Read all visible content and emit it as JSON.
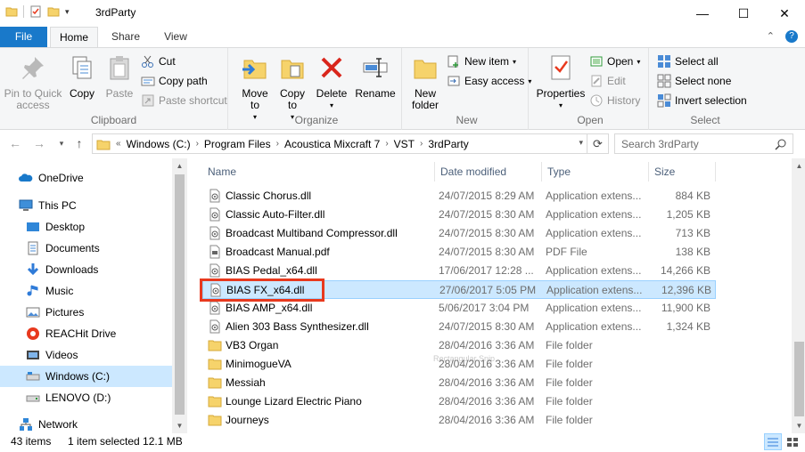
{
  "window": {
    "title": "3rdParty",
    "minimize": "—",
    "maximize": "☐",
    "close": "✕"
  },
  "tabs": {
    "file": "File",
    "home": "Home",
    "share": "Share",
    "view": "View"
  },
  "ribbon": {
    "clipboard": {
      "label": "Clipboard",
      "pin": "Pin to Quick access",
      "copy": "Copy",
      "paste": "Paste",
      "cut": "Cut",
      "copy_path": "Copy path",
      "paste_shortcut": "Paste shortcut"
    },
    "organize": {
      "label": "Organize",
      "move_to": "Move to",
      "copy_to": "Copy to",
      "delete": "Delete",
      "rename": "Rename"
    },
    "new": {
      "label": "New",
      "new_folder": "New folder",
      "new_item": "New item",
      "easy_access": "Easy access"
    },
    "open": {
      "label": "Open",
      "properties": "Properties",
      "open": "Open",
      "edit": "Edit",
      "history": "History"
    },
    "select": {
      "label": "Select",
      "select_all": "Select all",
      "select_none": "Select none",
      "invert": "Invert selection"
    }
  },
  "address": {
    "overflow": "«",
    "crumbs": [
      "Windows (C:)",
      "Program Files",
      "Acoustica Mixcraft 7",
      "VST",
      "3rdParty"
    ],
    "search_placeholder": "Search 3rdParty"
  },
  "nav": {
    "items": [
      {
        "label": "OneDrive",
        "icon": "cloud-icon"
      },
      {
        "label": "This PC",
        "icon": "computer-icon"
      },
      {
        "label": "Desktop",
        "icon": "desktop-icon"
      },
      {
        "label": "Documents",
        "icon": "documents-icon"
      },
      {
        "label": "Downloads",
        "icon": "download-icon"
      },
      {
        "label": "Music",
        "icon": "music-icon"
      },
      {
        "label": "Pictures",
        "icon": "pictures-icon"
      },
      {
        "label": "REACHit Drive",
        "icon": "reachit-icon"
      },
      {
        "label": "Videos",
        "icon": "videos-icon"
      },
      {
        "label": "Windows (C:)",
        "icon": "drive-icon"
      },
      {
        "label": "LENOVO (D:)",
        "icon": "drive-icon"
      },
      {
        "label": "Network",
        "icon": "network-icon"
      }
    ]
  },
  "columns": {
    "name": "Name",
    "date": "Date modified",
    "type": "Type",
    "size": "Size"
  },
  "files": [
    {
      "name": "Classic Chorus.dll",
      "date": "24/07/2015 8:29 AM",
      "type": "Application extens...",
      "size": "884 KB",
      "icon": "dll-icon"
    },
    {
      "name": "Classic Auto-Filter.dll",
      "date": "24/07/2015 8:30 AM",
      "type": "Application extens...",
      "size": "1,205 KB",
      "icon": "dll-icon"
    },
    {
      "name": "Broadcast Multiband Compressor.dll",
      "date": "24/07/2015 8:30 AM",
      "type": "Application extens...",
      "size": "713 KB",
      "icon": "dll-icon"
    },
    {
      "name": "Broadcast Manual.pdf",
      "date": "24/07/2015 8:30 AM",
      "type": "PDF File",
      "size": "138 KB",
      "icon": "pdf-icon"
    },
    {
      "name": "BIAS Pedal_x64.dll",
      "date": "17/06/2017 12:28 ...",
      "type": "Application extens...",
      "size": "14,266 KB",
      "icon": "dll-icon"
    },
    {
      "name": "BIAS FX_x64.dll",
      "date": "27/06/2017 5:05 PM",
      "type": "Application extens...",
      "size": "12,396 KB",
      "icon": "dll-icon",
      "selected": true
    },
    {
      "name": "BIAS AMP_x64.dll",
      "date": "5/06/2017 3:04 PM",
      "type": "Application extens...",
      "size": "11,900 KB",
      "icon": "dll-icon"
    },
    {
      "name": "Alien 303 Bass Synthesizer.dll",
      "date": "24/07/2015 8:30 AM",
      "type": "Application extens...",
      "size": "1,324 KB",
      "icon": "dll-icon"
    },
    {
      "name": "VB3 Organ",
      "date": "28/04/2016 3:36 AM",
      "type": "File folder",
      "size": "",
      "icon": "folder-icon"
    },
    {
      "name": "MinimogueVA",
      "date": "28/04/2016 3:36 AM",
      "type": "File folder",
      "size": "",
      "icon": "folder-icon"
    },
    {
      "name": "Messiah",
      "date": "28/04/2016 3:36 AM",
      "type": "File folder",
      "size": "",
      "icon": "folder-icon"
    },
    {
      "name": "Lounge Lizard Electric Piano",
      "date": "28/04/2016 3:36 AM",
      "type": "File folder",
      "size": "",
      "icon": "folder-icon"
    },
    {
      "name": "Journeys",
      "date": "28/04/2016 3:36 AM",
      "type": "File folder",
      "size": "",
      "icon": "folder-icon"
    }
  ],
  "ghost_text": "Rectangular Snip",
  "status": {
    "count": "43 items",
    "selected": "1 item selected  12.1 MB"
  },
  "colors": {
    "accent": "#1979ca",
    "selection": "#cce8ff",
    "highlight": "#e8391e"
  }
}
